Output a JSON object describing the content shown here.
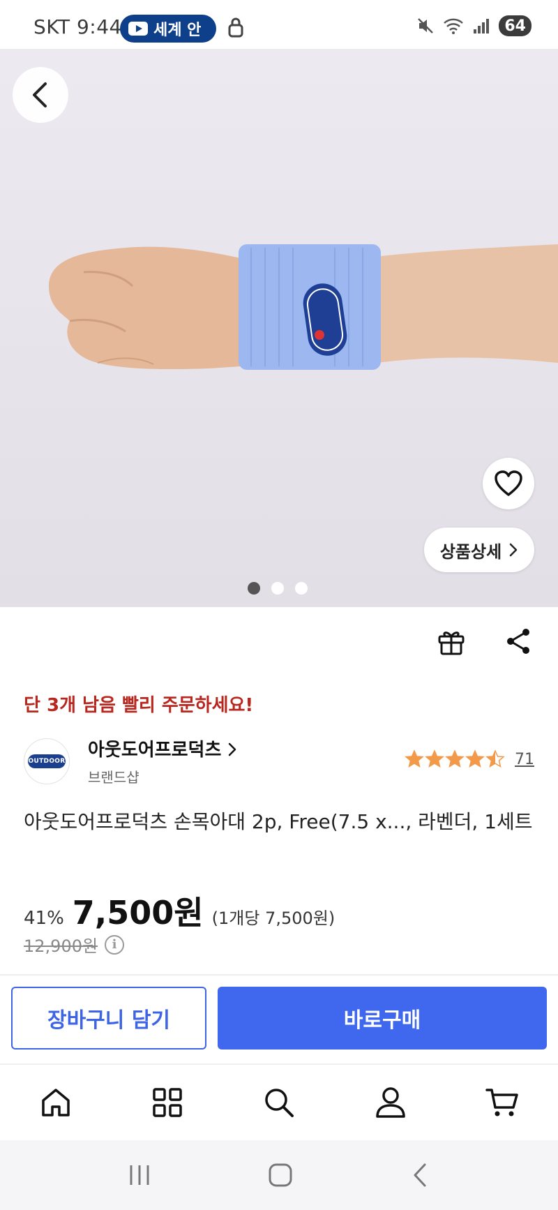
{
  "status_bar": {
    "carrier": "SKT",
    "time": "9:44",
    "pill_text": "세계 안",
    "battery": "64"
  },
  "hero": {
    "image_description_icon": "product-photo",
    "detail_button_label": "상품상세",
    "carousel": {
      "count": 3,
      "active_index": 0
    }
  },
  "product": {
    "stock_note": "단 3개 남음 빨리 주문하세요!",
    "brand": {
      "name": "아웃도어프로덕츠",
      "subtitle": "브랜드샵",
      "logo_text": "OUTDOOR"
    },
    "rating": {
      "stars": 4.5,
      "count": "71"
    },
    "title": "아웃도어프로덕츠 손목아대 2p, Free(7.5 x..., 라벤더, 1세트",
    "discount": "41%",
    "price": "7,500원",
    "unit_price": "(1개당 7,500원)",
    "original_price": "12,900원"
  },
  "actions": {
    "cart_label": "장바구니 담기",
    "buy_label": "바로구매"
  },
  "colors": {
    "accent": "#3f68ef",
    "stock_note": "#b8261d",
    "star": "#f2994a",
    "wristband": "#9db8f0"
  },
  "tab_bar": {
    "items": [
      "home-icon",
      "category-icon",
      "search-icon",
      "my-page-icon",
      "cart-icon"
    ]
  },
  "sys_nav": {
    "items": [
      "recents-icon",
      "home-icon",
      "back-icon"
    ]
  }
}
